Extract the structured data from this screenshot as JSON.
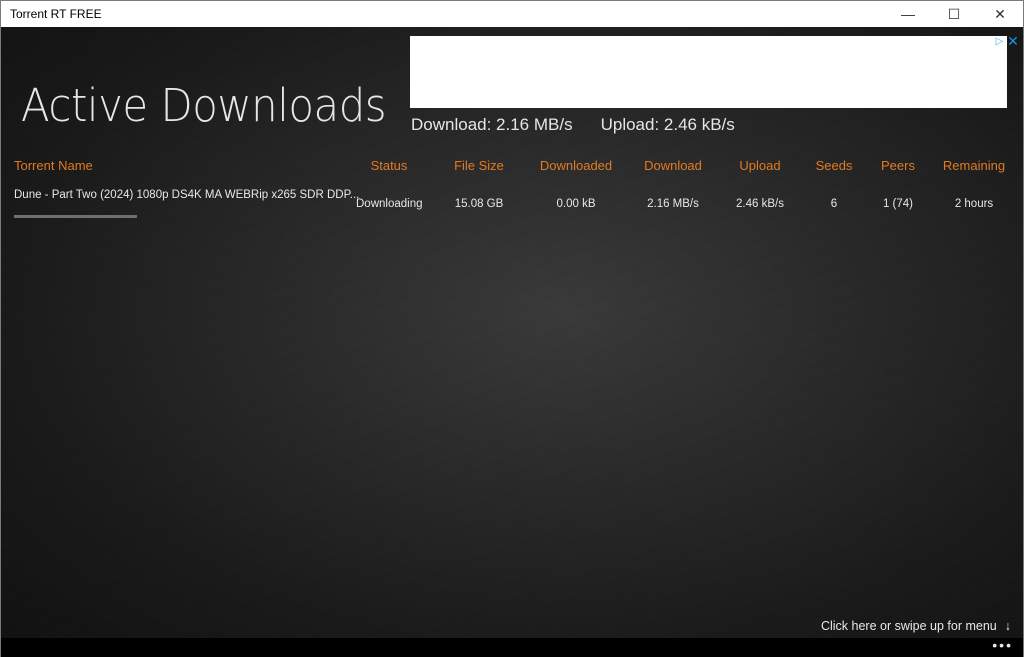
{
  "window": {
    "title": "Torrent RT FREE",
    "controls": {
      "minimize": "—",
      "maximize": "☐",
      "close": "✕"
    }
  },
  "page": {
    "title": "Active Downloads"
  },
  "ad": {
    "choices_icon": "▷",
    "close_icon": "✕"
  },
  "summary": {
    "download": "Download: 2.16 MB/s",
    "upload": "Upload: 2.46 kB/s"
  },
  "table": {
    "columns": [
      "Torrent Name",
      "Status",
      "File Size",
      "Downloaded",
      "Download",
      "Upload",
      "Seeds",
      "Peers",
      "Remaining"
    ],
    "rows": [
      {
        "name": "Dune - Part Two (2024) 1080p DS4K MA WEBRip x265 SDR DDP...",
        "status": "Downloading",
        "file_size": "15.08 GB",
        "downloaded": "0.00 kB",
        "download": "2.16 MB/s",
        "upload": "2.46 kB/s",
        "seeds": "6",
        "peers": "1 (74)",
        "remaining": "2 hours",
        "progress_percent": 100
      }
    ]
  },
  "footer": {
    "menu_hint": "Click here or swipe up for menu",
    "menu_hint_icon": "↓",
    "more_icon": "•••"
  },
  "colors": {
    "header_accent": "#e07b22",
    "text": "#e8e8e8"
  }
}
